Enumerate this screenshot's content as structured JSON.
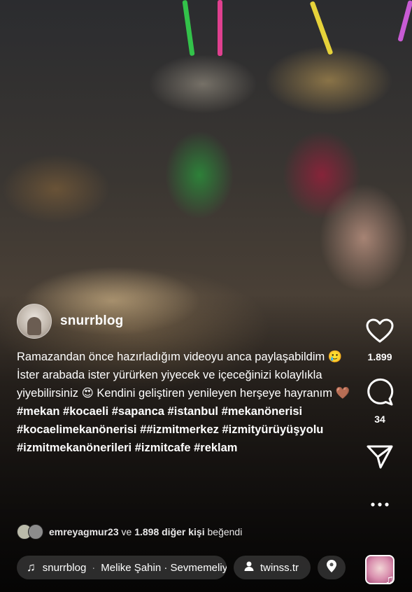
{
  "author": {
    "username": "snurrblog"
  },
  "caption": {
    "line1": "Ramazandan önce hazırladığım videoyu anca paylaşabildim 🥲",
    "line2": "İster arabada ister yürürken yiyecek ve içeceğinizi kolaylıkla yiyebilirsiniz 😍 Kendini geliştiren yenileyen herşeye hayranım 🤎",
    "hashtags": "#mekan #kocaeli #sapanca #istanbul #mekanönerisi #kocaelimekanönerisi ##izmitmerkez #izmityürüyüşyolu #izmitmekanönerileri #izmitcafe #reklam"
  },
  "likes": {
    "user": "emreyagmur23",
    "connector": "ve",
    "others": "1.898 diğer kişi",
    "suffix": "beğendi"
  },
  "actions": {
    "like_count": "1.899",
    "comment_count": "34"
  },
  "bottom": {
    "audio_owner": "snurrblog",
    "audio_track": "Melike Şahin · Sevmemeliyiz",
    "tagged_user": "twinss.tr"
  },
  "icons": {
    "like": "heart-icon",
    "comment": "comment-icon",
    "share": "send-icon",
    "more": "more-icon",
    "music": "music-note-icon",
    "person": "person-icon",
    "location": "location-pin-icon"
  }
}
